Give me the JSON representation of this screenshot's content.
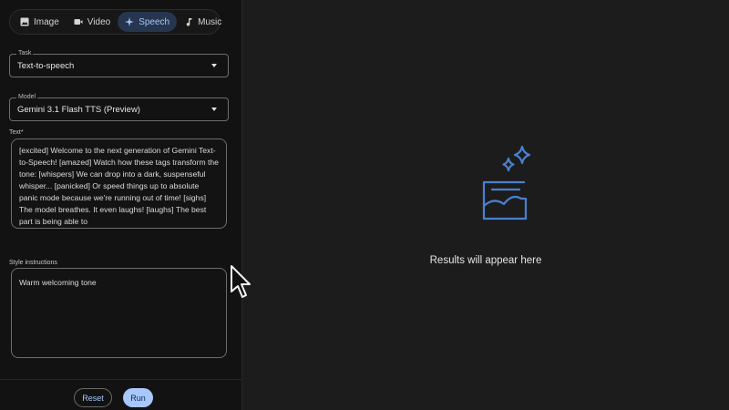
{
  "tabs": [
    {
      "label": "Image",
      "icon": "image-icon",
      "active": false
    },
    {
      "label": "Video",
      "icon": "video-icon",
      "active": false
    },
    {
      "label": "Speech",
      "icon": "speech-icon",
      "active": true
    },
    {
      "label": "Music",
      "icon": "music-note-icon",
      "active": false
    }
  ],
  "task": {
    "label": "Task",
    "value": "Text-to-speech"
  },
  "model": {
    "label": "Model",
    "value": "Gemini 3.1 Flash TTS (Preview)"
  },
  "text_field": {
    "label": "Text*",
    "value": "[excited] Welcome to the next generation of Gemini Text-to-Speech! [amazed] Watch how these tags transform the tone: [whispers] We can drop into a dark, suspenseful whisper... [panicked] Or speed things up to absolute panic mode because we're running out of time! [sighs] The model breathes. It even laughs! [laughs] The best part is being able to"
  },
  "style_field": {
    "label": "Style instructions",
    "value": "Warm welcoming tone"
  },
  "actions": {
    "reset": "Reset",
    "run": "Run"
  },
  "empty_state": {
    "message": "Results will appear here",
    "icon": "sparkle-results-icon"
  },
  "colors": {
    "accent": "#a8c7fa",
    "active_tab_bg": "#26364e",
    "illustration": "#4a80d0"
  }
}
